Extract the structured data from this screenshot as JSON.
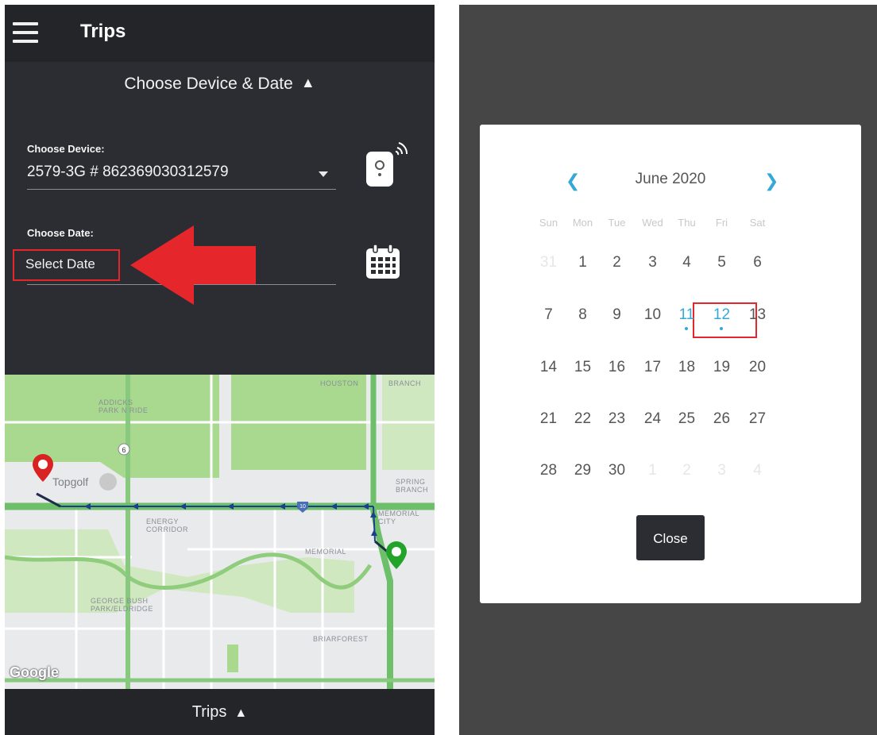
{
  "app": {
    "title": "Trips",
    "menu_icon": "hamburger-menu-icon"
  },
  "chooser": {
    "header": "Choose Device & Date",
    "device_label": "Choose Device:",
    "device_value": "2579-3G # 862369030312579",
    "date_label": "Choose Date:",
    "date_placeholder": "Select Date"
  },
  "map": {
    "labels": [
      "ADDICKS PARK N RIDE",
      "HOUSTON",
      "BRANCH",
      "ENERGY CORRIDOR",
      "MEMORIAL",
      "SPRING BRANCH",
      "MEMORIAL CITY",
      "GEORGE BUSH PARK/ELDRIDGE",
      "BRIARFOREST"
    ],
    "poi": "Topgolf",
    "route_shield": "10",
    "highway_shield": "6",
    "attribution": "Google"
  },
  "footer": {
    "label": "Trips"
  },
  "calendar": {
    "month": "June 2020",
    "weekdays": [
      "Sun",
      "Mon",
      "Tue",
      "Wed",
      "Thu",
      "Fri",
      "Sat"
    ],
    "weeks": [
      [
        "31",
        "1",
        "2",
        "3",
        "4",
        "5",
        "6"
      ],
      [
        "7",
        "8",
        "9",
        "10",
        "11",
        "12",
        "13"
      ],
      [
        "14",
        "15",
        "16",
        "17",
        "18",
        "19",
        "20"
      ],
      [
        "21",
        "22",
        "23",
        "24",
        "25",
        "26",
        "27"
      ],
      [
        "28",
        "29",
        "30",
        "1",
        "2",
        "3",
        "4"
      ]
    ],
    "marked_days": [
      "11",
      "12"
    ],
    "close_label": "Close",
    "accent_color": "#35a8d8"
  },
  "colors": {
    "highlight": "#e5262b",
    "dark_bg": "#2b2d33",
    "route_green": "#6dbf6a"
  }
}
